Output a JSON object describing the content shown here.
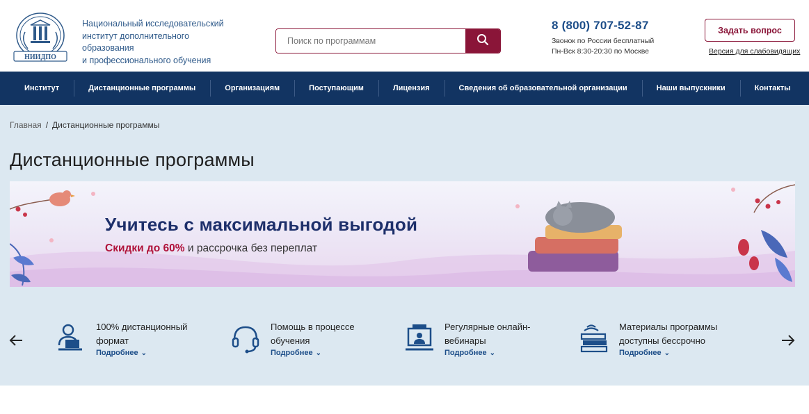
{
  "header": {
    "org_line1": "Национальный исследовательский",
    "org_line2": "институт дополнительного образования",
    "org_line3": "и профессионального обучения",
    "logo_text": "НИИДПО",
    "search_placeholder": "Поиск по программам",
    "phone": "8 (800) 707-52-87",
    "phone_note1": "Звонок по России бесплатный",
    "phone_note2": "Пн-Вск 8:30-20:30 по Москве",
    "ask_button": "Задать вопрос",
    "low_vision_link": "Версия для слабовидящих"
  },
  "nav": {
    "items": [
      "Институт",
      "Дистанционные программы",
      "Организациям",
      "Поступающим",
      "Лицензия",
      "Сведения об образовательной организации",
      "Наши выпускники",
      "Контакты"
    ]
  },
  "breadcrumb": {
    "home": "Главная",
    "separator": "/",
    "current": "Дистанционные программы"
  },
  "page_title": "Дистанционные программы",
  "banner": {
    "title": "Учитесь с максимальной выгодой",
    "sub_accent": "Скидки до 60%",
    "sub_rest": " и рассрочка без переплат"
  },
  "features": {
    "more_label": "Подробнее",
    "items": [
      {
        "line1": "100% дистанционный",
        "line2": "формат",
        "icon": "remote-learner-icon"
      },
      {
        "line1": "Помощь в процессе",
        "line2": "обучения",
        "icon": "headset-icon"
      },
      {
        "line1": "Регулярные онлайн-",
        "line2": "вебинары",
        "icon": "webinar-icon"
      },
      {
        "line1": "Материалы программы",
        "line2": "доступны бессрочно",
        "icon": "books-stack-icon"
      }
    ]
  },
  "colors": {
    "brand_red": "#8a1538",
    "nav_blue": "#123462",
    "link_blue": "#1d4e89",
    "main_bg": "#dce8f1"
  }
}
